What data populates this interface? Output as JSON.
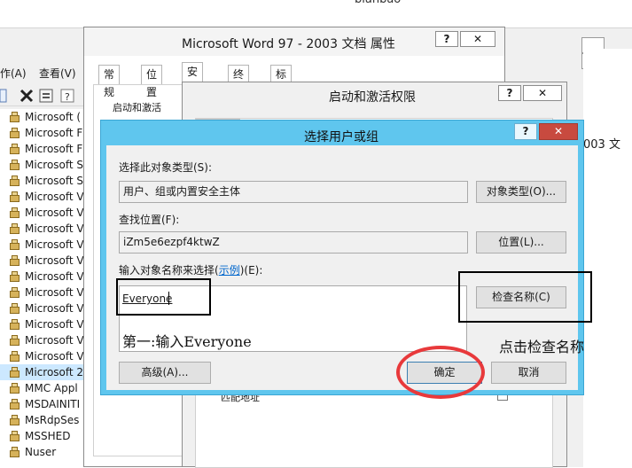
{
  "background_window": {
    "title": "bianbao",
    "window_buttons": [
      "_",
      "□"
    ],
    "menu": [
      "作(A)",
      "查看(V)"
    ],
    "tree_items": [
      "Microsoft (",
      "Microsoft F",
      "Microsoft F",
      "Microsoft S",
      "Microsoft S",
      "Microsoft V",
      "Microsoft V",
      "Microsoft V",
      "Microsoft V",
      "Microsoft V",
      "Microsoft V",
      "Microsoft V",
      "Microsoft V",
      "Microsoft V",
      "Microsoft V",
      "Microsoft V",
      "Microsoft 2",
      "MMC Appl",
      "MSDAINITI",
      "MsRdpSes",
      "MSSHED",
      "Nuser"
    ],
    "selected_tree_index": 16,
    "right_text": "003 文"
  },
  "properties_dialog": {
    "title": "Microsoft Word 97 - 2003 文档 属性",
    "help_label": "?",
    "close_label": "✕",
    "tabs": [
      "常规",
      "位置",
      "安全",
      "终结点",
      "标识"
    ],
    "active_tab": "安全",
    "group_label": "启动和激活"
  },
  "launch_dialog": {
    "title": "启动和激活权限",
    "help_label": "?",
    "close_label": "✕",
    "partial_text": "匹配地址"
  },
  "select_dialog": {
    "title": "选择用户或组",
    "help_label": "?",
    "close_label": "✕",
    "object_type_label": "选择此对象类型(S):",
    "object_type_value": "用户、组或内置安全主体",
    "object_type_button": "对象类型(O)...",
    "location_label": "查找位置(F):",
    "location_value": "iZm5e6ezpf4ktwZ",
    "location_button": "位置(L)...",
    "names_label_pre": "输入对象名称来选择(",
    "names_label_link": "示例",
    "names_label_post": ")(E):",
    "names_value": "Everyone",
    "check_names_button": "检查名称(C)",
    "advanced_button": "高级(A)...",
    "ok_button": "确定",
    "cancel_button": "取消"
  },
  "annotations": {
    "step1_text": "第一:输入Everyone",
    "click_check_text": "点击检查名称",
    "color_red": "#e8393b"
  }
}
